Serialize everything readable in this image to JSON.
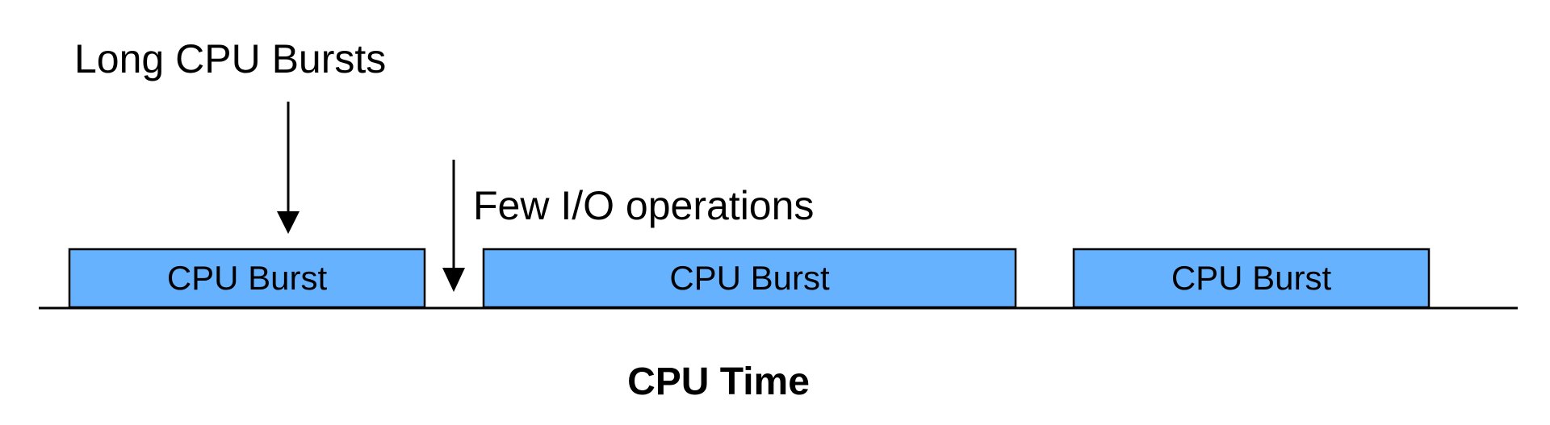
{
  "annotations": {
    "long_bursts": "Long CPU Bursts",
    "few_io": "Few I/O operations"
  },
  "bursts": [
    {
      "label": "CPU Burst"
    },
    {
      "label": "CPU Burst"
    },
    {
      "label": "CPU Burst"
    }
  ],
  "axis": {
    "title": "CPU Time"
  },
  "colors": {
    "burst_fill": "#66B2FF",
    "stroke": "#000000",
    "text": "#000000"
  }
}
